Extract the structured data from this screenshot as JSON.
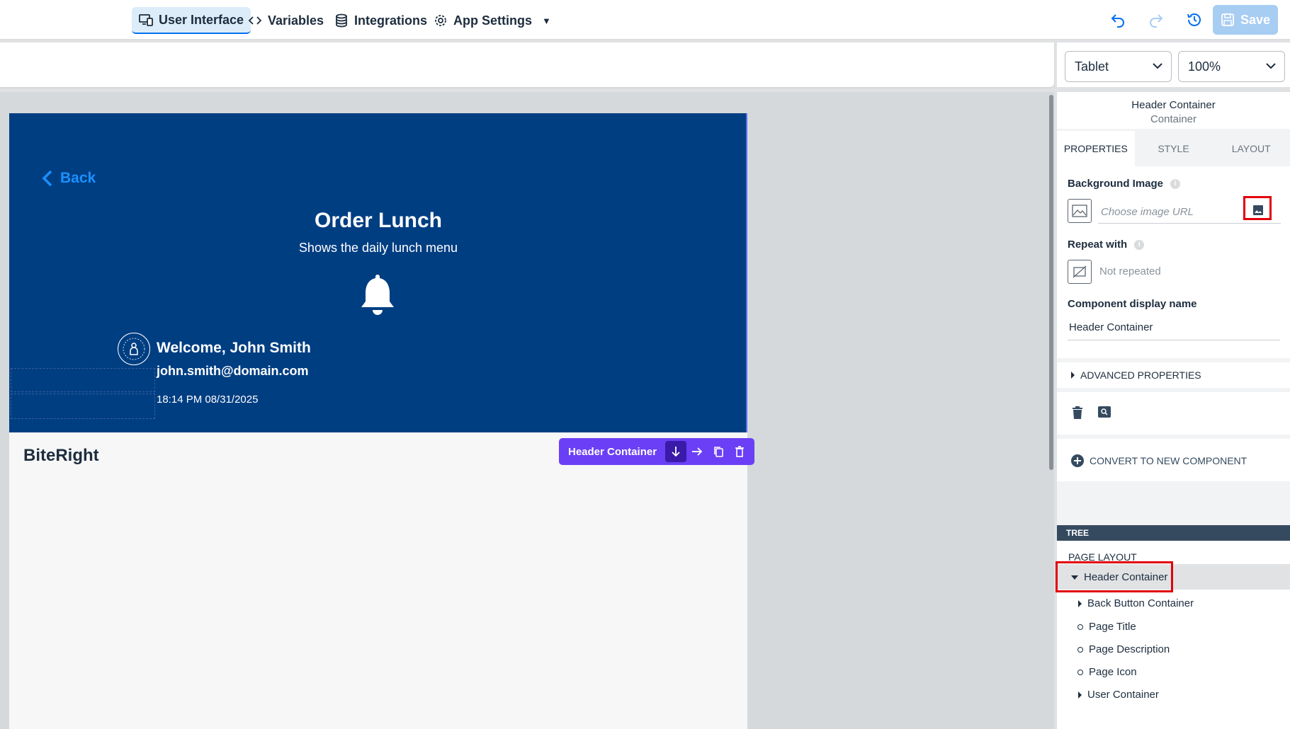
{
  "topnav": {
    "tabs": [
      {
        "label": "User Interface",
        "icon": "devices-icon"
      },
      {
        "label": "Variables",
        "icon": "code-icon"
      },
      {
        "label": "Integrations",
        "icon": "database-icon"
      },
      {
        "label": "App Settings",
        "icon": "gear-icon"
      }
    ],
    "save_label": "Save"
  },
  "viewport": {
    "device": "Tablet",
    "zoom": "100%"
  },
  "canvas": {
    "back_label": "Back",
    "page_title": "Order Lunch",
    "page_description": "Shows the daily lunch menu",
    "welcome": "Welcome, John Smith",
    "email": "john.smith@domain.com",
    "datetime": "18:14 PM 08/31/2025",
    "brand": "BiteRight",
    "selection_label": "Header Container"
  },
  "panel": {
    "component_name": "Header Container",
    "component_type": "Container",
    "tabs": [
      "PROPERTIES",
      "STYLE",
      "LAYOUT"
    ],
    "background_image_label": "Background Image",
    "background_image_placeholder": "Choose image URL",
    "repeat_label": "Repeat with",
    "repeat_value": "Not repeated",
    "display_name_label": "Component display name",
    "display_name_value": "Header Container",
    "advanced": "ADVANCED PROPERTIES",
    "convert": "CONVERT TO NEW COMPONENT",
    "tree_label": "TREE",
    "page_layout": "PAGE LAYOUT",
    "tree_items": [
      {
        "label": "Header Container",
        "kind": "expanded"
      },
      {
        "label": "Back Button Container",
        "kind": "collapsed"
      },
      {
        "label": "Page Title",
        "kind": "leaf"
      },
      {
        "label": "Page Description",
        "kind": "leaf"
      },
      {
        "label": "Page Icon",
        "kind": "leaf"
      },
      {
        "label": "User Container",
        "kind": "collapsed"
      }
    ]
  },
  "colors": {
    "header_bg": "#003e82",
    "accent": "#0070f2",
    "selection": "#6b3ff5",
    "highlight": "#e2000b"
  }
}
